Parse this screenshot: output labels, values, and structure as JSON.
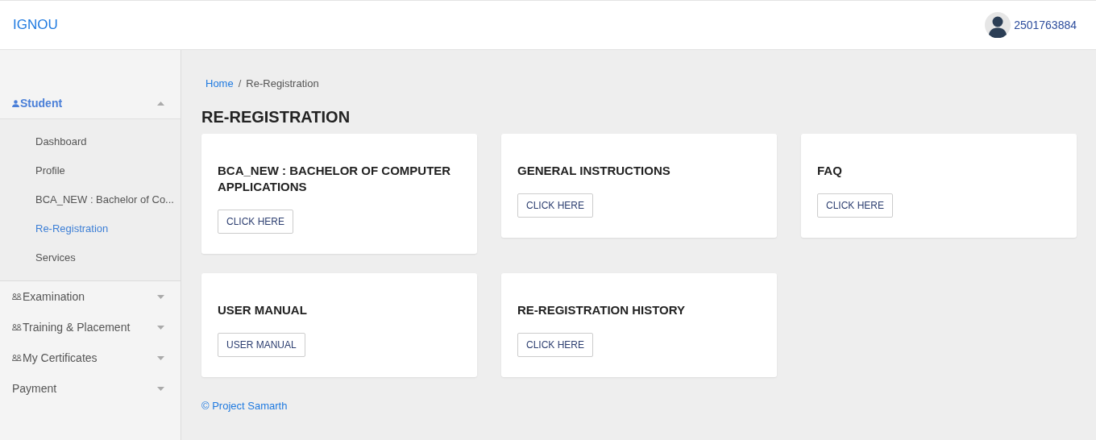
{
  "header": {
    "brand": "IGNOU",
    "user": "2501763884"
  },
  "sidebar": [
    {
      "label": "Student",
      "kind": "person",
      "expanded": true,
      "children": [
        {
          "label": "Dashboard",
          "selected": false
        },
        {
          "label": "Profile",
          "selected": false
        },
        {
          "label": "BCA_NEW : Bachelor of Co...",
          "selected": false
        },
        {
          "label": "Re-Registration",
          "selected": true
        },
        {
          "label": "Services",
          "selected": false
        }
      ]
    },
    {
      "label": "Examination",
      "kind": "group",
      "expanded": false
    },
    {
      "label": "Training & Placement",
      "kind": "group",
      "expanded": false
    },
    {
      "label": "My Certificates",
      "kind": "group",
      "expanded": false
    },
    {
      "label": "Payment",
      "kind": "plain",
      "expanded": false
    }
  ],
  "breadcrumb": [
    {
      "label": "Home",
      "kind": "link"
    },
    {
      "label": "Re-Registration",
      "kind": "current"
    }
  ],
  "breadcrumb_separator": "/",
  "page_title": "RE-REGISTRATION",
  "cards": [
    {
      "title": "BCA_NEW : BACHELOR OF COMPUTER APPLICATIONS",
      "button": "CLICK HERE"
    },
    {
      "title": "GENERAL INSTRUCTIONS",
      "button": "CLICK HERE"
    },
    {
      "title": "FAQ",
      "button": "CLICK HERE"
    },
    {
      "title": "USER MANUAL",
      "button": "USER MANUAL"
    },
    {
      "title": "RE-REGISTRATION HISTORY",
      "button": "CLICK HERE"
    }
  ],
  "footer": "© Project Samarth"
}
